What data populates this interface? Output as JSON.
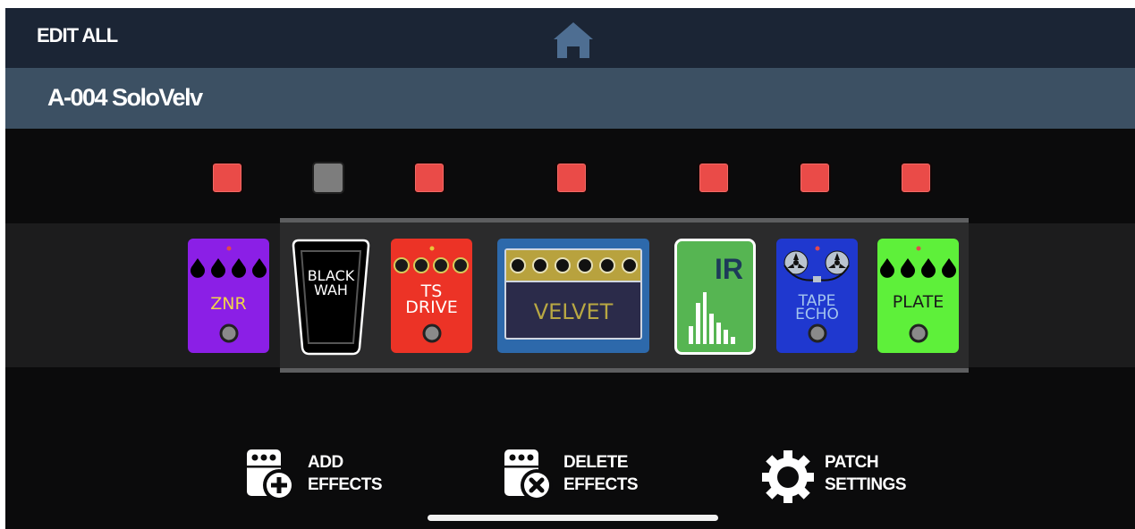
{
  "header": {
    "edit_all": "EDIT ALL",
    "home_icon": "home-icon"
  },
  "patch": {
    "name": "A-004 SoloVelv"
  },
  "colors": {
    "switch_on": "#ea4b48",
    "switch_off": "#7d7d7d",
    "topbar": "#1b2535",
    "patchbar": "#3c5063"
  },
  "effects": [
    {
      "name": "ZNR",
      "enabled": true,
      "color": "#8b1fe6",
      "text_color": "#f0d34a"
    },
    {
      "name": "BLACK WAH",
      "line1": "BLACK",
      "line2": "WAH",
      "enabled": false,
      "color": "#000000",
      "text_color": "#ffffff"
    },
    {
      "name": "TS DRIVE",
      "line1": "TS",
      "line2": "DRIVE",
      "enabled": true,
      "color": "#ec3326",
      "text_color": "#ffffff"
    },
    {
      "name": "VELVET",
      "enabled": true,
      "color": "#2d69ab",
      "text_color": "#b9a843"
    },
    {
      "name": "IR",
      "enabled": true,
      "color": "#56b552",
      "text_color": "#1d3a59"
    },
    {
      "name": "TAPE ECHO",
      "line1": "TAPE",
      "line2": "ECHO",
      "enabled": true,
      "color": "#1f38cf",
      "text_color": "#a3c4ee"
    },
    {
      "name": "PLATE",
      "enabled": true,
      "color": "#5ef03a",
      "text_color": "#1a1a1a"
    }
  ],
  "actions": {
    "add": {
      "line1": "ADD",
      "line2": "EFFECTS",
      "icon": "add-effects-icon"
    },
    "delete": {
      "line1": "DELETE",
      "line2": "EFFECTS",
      "icon": "delete-effects-icon"
    },
    "settings": {
      "line1": "PATCH",
      "line2": "SETTINGS",
      "icon": "gear-icon"
    }
  }
}
